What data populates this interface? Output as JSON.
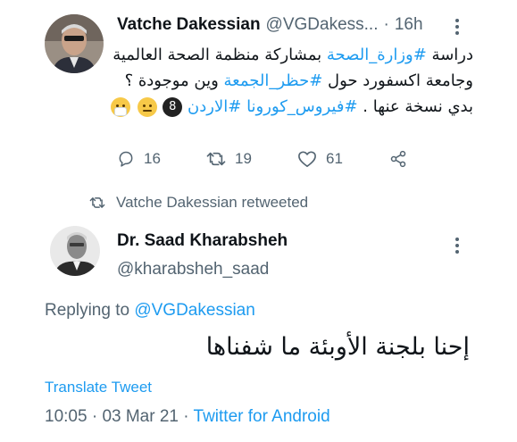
{
  "tweet1": {
    "author_name": "Vatche Dakessian",
    "author_handle": "@VGDakess...",
    "separator": "·",
    "time": "16h",
    "body": {
      "w1": "دراسة",
      "tag1": "#وزارة_الصحة",
      "w2": "بمشاركة منظمة الصحة العالمية وجامعة اكسفورد حول",
      "tag2": "#حظر_الجمعة",
      "w3": "وين موجودة ؟ بدي نسخة عنها .",
      "tag3": "#فيروس_كورونا",
      "tag4": "#الاردن",
      "badge": "8"
    },
    "replies": "16",
    "retweets": "19",
    "likes": "61"
  },
  "retweet_banner": "Vatche Dakessian retweeted",
  "tweet2": {
    "author_name": "Dr. Saad Kharabsheh",
    "author_handle": "@kharabsheh_saad",
    "replying_prefix": "Replying to",
    "replying_mention": "@VGDakessian",
    "body": "إحنا بلجنة الأوبئة ما شفناها",
    "translate": "Translate Tweet",
    "time": "10:05",
    "date": "03 Mar 21",
    "separator": "·",
    "source": "Twitter for Android"
  },
  "colors": {
    "accent": "#1d9bf0",
    "muted": "#536471",
    "text": "#0f1419"
  },
  "icons": {
    "reply": "reply-icon",
    "retweet": "retweet-icon",
    "like": "heart-icon",
    "share": "share-icon",
    "more": "more-vertical-icon"
  }
}
